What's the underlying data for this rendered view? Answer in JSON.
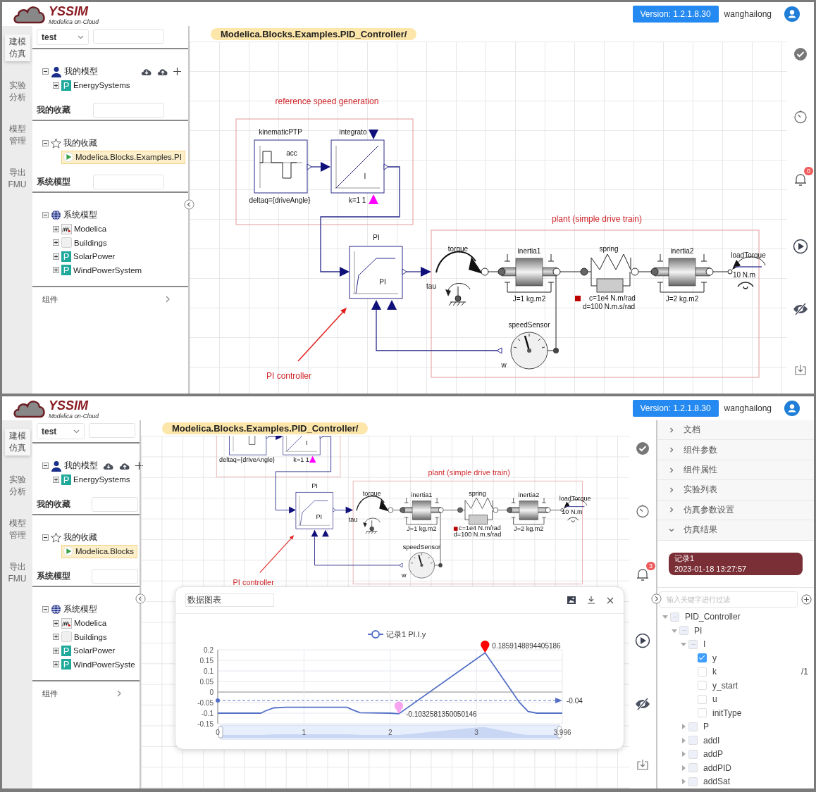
{
  "panes": [
    {
      "header": {
        "title": "YSSIM",
        "subtitle": "Modelica on-Cloud",
        "version": "Version: 1.2.1.8.30",
        "user": "wanghailong"
      },
      "nav": [
        {
          "label": "建模仿真",
          "selected": true
        },
        {
          "label": "实验分析",
          "selected": false
        },
        {
          "label": "模型管理",
          "selected": false
        },
        {
          "label": "导出 FMU",
          "selected": false
        }
      ],
      "sidebar": {
        "select": "test",
        "groups": [
          {
            "tree": [
              {
                "label": "我的模型",
                "kind": "user",
                "expanded": true,
                "selected": false,
                "children": [
                  {
                    "label": "EnergySystems",
                    "kind": "package",
                    "icon_letter": "P",
                    "expanded": false,
                    "selected": false
                  }
                ]
              }
            ]
          },
          {
            "title": "我的收藏",
            "tree": [
              {
                "label": "我的收藏",
                "kind": "star",
                "expanded": true,
                "selected": false,
                "children": [
                  {
                    "label": "Modelica.Blocks.Examples.PI",
                    "kind": "model",
                    "selected": true
                  }
                ]
              }
            ]
          },
          {
            "title": "系统模型",
            "tree": [
              {
                "label": "系统模型",
                "kind": "globe",
                "expanded": true,
                "selected": false,
                "children": [
                  {
                    "label": "Modelica",
                    "kind": "modelica",
                    "expanded": false,
                    "selected": false
                  },
                  {
                    "label": "Buildings",
                    "kind": "blank",
                    "expanded": false,
                    "selected": false
                  },
                  {
                    "label": "SolarPower",
                    "kind": "package",
                    "icon_letter": "P",
                    "expanded": false,
                    "selected": false
                  },
                  {
                    "label": "WindPowerSystem",
                    "kind": "package",
                    "icon_letter": "P",
                    "expanded": false,
                    "selected": false
                  }
                ]
              }
            ]
          }
        ],
        "footer": "组件"
      },
      "breadcrumb": "Modelica.Blocks.Examples.PID_Controller/",
      "diagram": {
        "labels": [
          {
            "kind": "ref_title",
            "text": "reference speed generation"
          },
          {
            "kind": "kinematic_name",
            "text": "kinematicPTP"
          },
          {
            "kind": "acc",
            "text": "acc"
          },
          {
            "kind": "deltaq",
            "text": "deltaq={driveAngle}"
          },
          {
            "kind": "integrator_name",
            "text": "integrato"
          },
          {
            "kind": "i_label",
            "text": "I"
          },
          {
            "kind": "k_param",
            "text": "k=1 1"
          },
          {
            "kind": "pi_name",
            "text": "PI"
          },
          {
            "kind": "pi_inner",
            "text": "PI"
          },
          {
            "kind": "tau",
            "text": "tau"
          },
          {
            "kind": "torque",
            "text": "torque"
          },
          {
            "kind": "inertia1",
            "text": "inertia1"
          },
          {
            "kind": "j1",
            "text": "J=1 kg.m2"
          },
          {
            "kind": "spring",
            "text": "spring"
          },
          {
            "kind": "c_param",
            "text": "c=1e4 N.m/rad"
          },
          {
            "kind": "d_param",
            "text": "d=100 N.m.s/rad"
          },
          {
            "kind": "inertia2",
            "text": "inertia2"
          },
          {
            "kind": "j2",
            "text": "J=2 kg.m2"
          },
          {
            "kind": "load_torque",
            "text": "loadTorque"
          },
          {
            "kind": "load_value",
            "text": "10 N.m"
          },
          {
            "kind": "speed_sensor",
            "text": "speedSensor"
          },
          {
            "kind": "w",
            "text": "w"
          },
          {
            "kind": "plant_title",
            "text": "plant (simple drive train)"
          },
          {
            "kind": "pi_controller",
            "text": "PI controller"
          }
        ]
      },
      "tools": [
        {
          "kind": "check"
        },
        {
          "kind": "timer"
        },
        {
          "kind": "bell",
          "badge": "0"
        },
        {
          "kind": "play"
        },
        {
          "kind": "hide"
        },
        {
          "kind": "download"
        }
      ]
    },
    {
      "header": {
        "title": "YSSIM",
        "subtitle": "Modelica on-Cloud",
        "version": "Version: 1.2.1.8.30",
        "user": "wanghailong"
      },
      "nav": [
        {
          "label": "建模仿真",
          "selected": true
        },
        {
          "label": "实验分析",
          "selected": false
        },
        {
          "label": "模型管理",
          "selected": false
        },
        {
          "label": "导出 FMU",
          "selected": false
        }
      ],
      "sidebar": {
        "select": "test",
        "groups": [
          {
            "tree": [
              {
                "label": "我的模型",
                "kind": "user",
                "expanded": true,
                "selected": false,
                "children": [
                  {
                    "label": "EnergySystems",
                    "kind": "package",
                    "icon_letter": "P",
                    "expanded": false,
                    "selected": false
                  }
                ]
              }
            ]
          },
          {
            "title": "我的收藏",
            "tree": [
              {
                "label": "我的收藏",
                "kind": "star",
                "expanded": true,
                "selected": false,
                "children": [
                  {
                    "label": "Modelica.Blocks",
                    "kind": "model",
                    "selected": true
                  }
                ]
              }
            ]
          },
          {
            "title": "系统模型",
            "tree": [
              {
                "label": "系统模型",
                "kind": "globe",
                "expanded": true,
                "selected": false,
                "children": [
                  {
                    "label": "Modelica",
                    "kind": "modelica",
                    "expanded": false,
                    "selected": false
                  },
                  {
                    "label": "Buildings",
                    "kind": "blank",
                    "expanded": false,
                    "selected": false
                  },
                  {
                    "label": "SolarPower",
                    "kind": "package",
                    "icon_letter": "P",
                    "expanded": false,
                    "selected": false
                  },
                  {
                    "label": "WindPowerSyste",
                    "kind": "package",
                    "icon_letter": "P",
                    "expanded": false,
                    "selected": false
                  }
                ]
              }
            ]
          }
        ],
        "footer": "组件"
      },
      "breadcrumb": "Modelica.Blocks.Examples.PID_Controller/",
      "diagram": {
        "labels": [
          {
            "kind": "deltaq",
            "text": "deltaq={driveAngle}"
          },
          {
            "kind": "i_label",
            "text": "I"
          },
          {
            "kind": "k_param",
            "text": "k=1 1"
          },
          {
            "kind": "pi_name",
            "text": "PI"
          },
          {
            "kind": "pi_inner",
            "text": "PI"
          },
          {
            "kind": "tau",
            "text": "tau"
          },
          {
            "kind": "torque",
            "text": "torque"
          },
          {
            "kind": "inertia1",
            "text": "inertia1"
          },
          {
            "kind": "j1",
            "text": "J=1 kg.m2"
          },
          {
            "kind": "spring",
            "text": "spring"
          },
          {
            "kind": "c_param",
            "text": "c=1e4 N.m/rad"
          },
          {
            "kind": "d_param",
            "text": "d=100 N.m.s/rad"
          },
          {
            "kind": "inertia2",
            "text": "inertia2"
          },
          {
            "kind": "j2",
            "text": "J=2 kg.m2"
          },
          {
            "kind": "load_torque",
            "text": "loadTorque"
          },
          {
            "kind": "load_value",
            "text": "10 N.m"
          },
          {
            "kind": "speed_sensor",
            "text": "speedSensor"
          },
          {
            "kind": "w",
            "text": "w"
          },
          {
            "kind": "plant_title",
            "text": "plant (simple drive train)"
          },
          {
            "kind": "pi_controller",
            "text": "PI controller"
          }
        ]
      },
      "tools": [
        {
          "kind": "check"
        },
        {
          "kind": "timer"
        },
        {
          "kind": "bell",
          "badge": "3"
        },
        {
          "kind": "play"
        },
        {
          "kind": "hide"
        },
        {
          "kind": "download"
        }
      ],
      "chart_dialog": {
        "title": "数据图表",
        "chart_data": {
          "type": "line",
          "x": [
            0,
            0.5,
            0.55,
            0.65,
            0.8,
            1.5,
            1.55,
            1.65,
            2.0,
            2.1,
            3.1,
            3.5,
            3.6,
            3.7,
            3.996
          ],
          "series": [
            {
              "name": "记录1 PI.I.y",
              "color": "#5470c6",
              "values": [
                -0.1,
                -0.1,
                -0.09,
                -0.075,
                -0.072,
                -0.072,
                -0.082,
                -0.098,
                -0.1,
                -0.103,
                0.186,
                -0.05,
                -0.092,
                -0.1,
                -0.1
              ]
            }
          ],
          "xlim": [
            0,
            3.996
          ],
          "ylim": [
            -0.15,
            0.2
          ],
          "xticks": [
            0,
            1,
            2,
            3,
            {
              "value": 3.996,
              "label": "3.996"
            }
          ],
          "yticks": [
            -0.15,
            -0.1,
            -0.05,
            0,
            0.05,
            0.1,
            0.15,
            0.2
          ],
          "grid": true,
          "annotations": [
            {
              "text": "0.1859148894405186",
              "x": 3.1,
              "y": 0.186
            },
            {
              "text": "-0.1032581350050146",
              "x": 2.1,
              "y": -0.103
            }
          ],
          "ref_lines": [
            {
              "axis": "y",
              "value": -0.04,
              "label": "-0.04",
              "color": "#5470c6"
            }
          ]
        }
      },
      "side_panel": {
        "sections": [
          {
            "label": "文档",
            "expanded": false
          },
          {
            "label": "组件参数",
            "expanded": false
          },
          {
            "label": "组件属性",
            "expanded": false
          },
          {
            "label": "实验列表",
            "expanded": false
          },
          {
            "label": "仿真参数设置",
            "expanded": false
          },
          {
            "label": "仿真结果",
            "expanded": true
          }
        ],
        "records": [
          {
            "name": "记录1",
            "time": "2023-01-18 13:27:57",
            "selected": true
          }
        ],
        "filter_placeholder": "输入关键字进行过滤",
        "tree": [
          {
            "label": "PID_Controller",
            "checked": false,
            "indeterminate": true,
            "expanded": true,
            "children": [
              {
                "label": "PI",
                "checked": false,
                "indeterminate": true,
                "expanded": true,
                "children": [
                  {
                    "label": "I",
                    "checked": false,
                    "indeterminate": true,
                    "expanded": true,
                    "children": [
                      {
                        "label": "y",
                        "checked": true
                      },
                      {
                        "label": "k",
                        "checked": false,
                        "suffix": "/1"
                      },
                      {
                        "label": "y_start",
                        "checked": false
                      },
                      {
                        "label": "u",
                        "checked": false
                      },
                      {
                        "label": "initType",
                        "checked": false
                      }
                    ]
                  },
                  {
                    "label": "P",
                    "checked": false,
                    "expanded": false
                  },
                  {
                    "label": "addI",
                    "checked": false,
                    "expanded": false
                  },
                  {
                    "label": "addP",
                    "checked": false,
                    "expanded": false
                  },
                  {
                    "label": "addPID",
                    "checked": false,
                    "expanded": false
                  },
                  {
                    "label": "addSat",
                    "checked": false,
                    "expanded": false
                  }
                ]
              }
            ]
          }
        ]
      }
    }
  ]
}
